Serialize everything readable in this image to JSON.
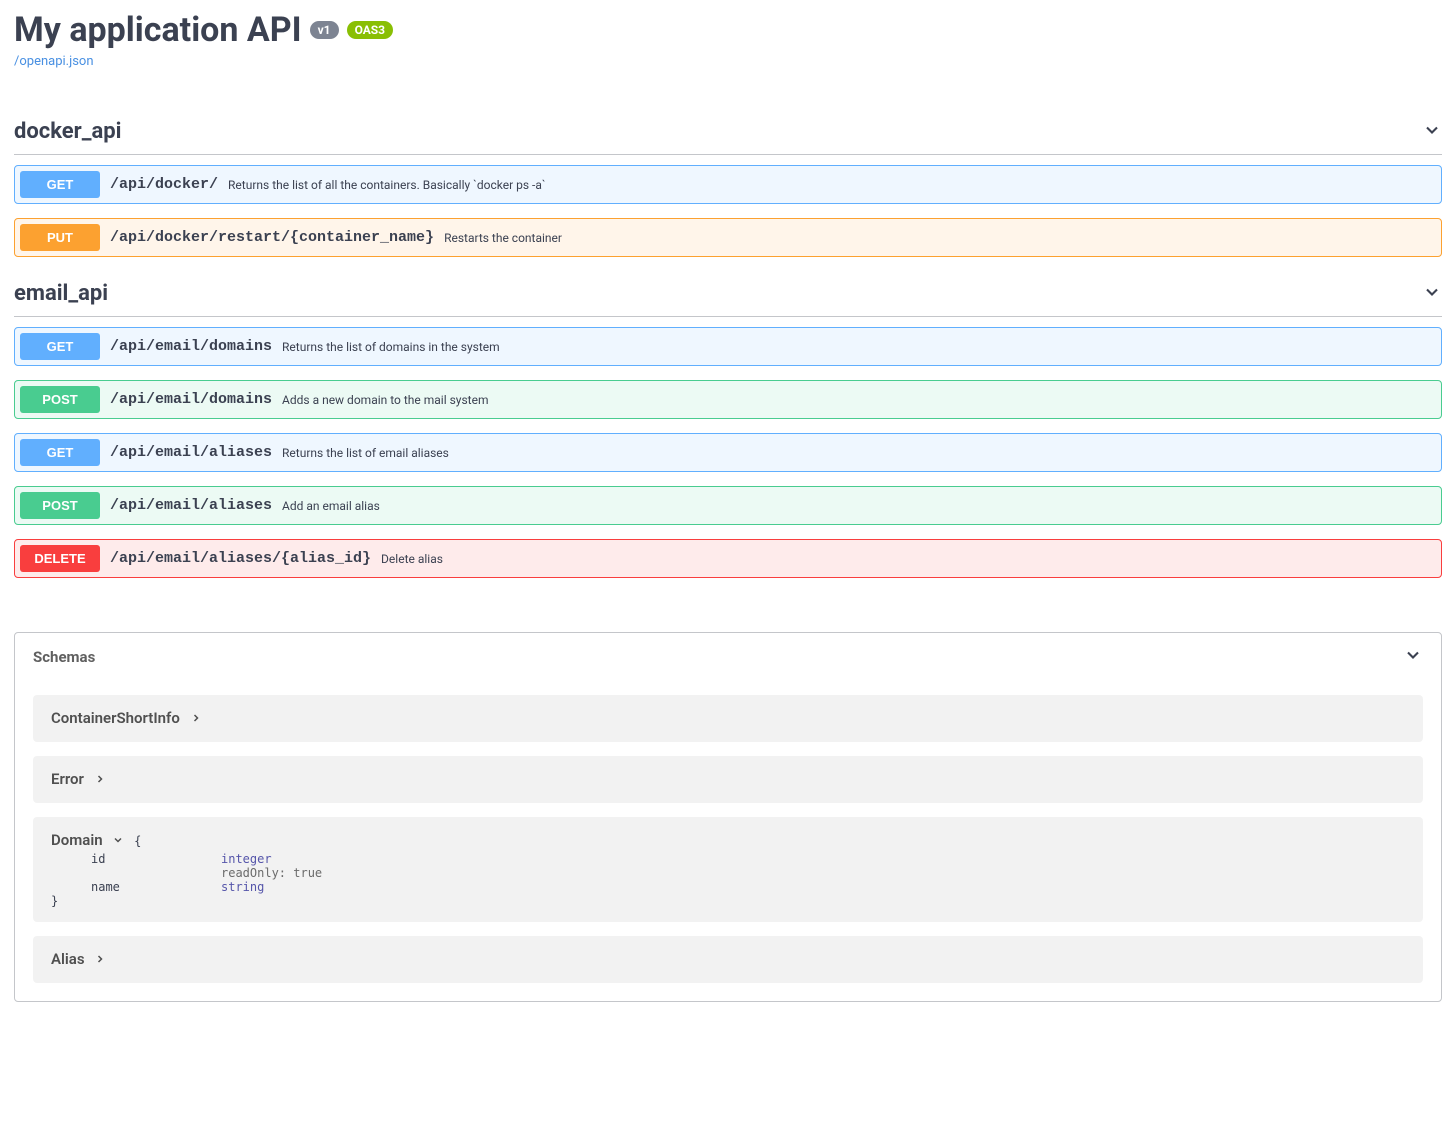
{
  "header": {
    "title": "My application API",
    "version": "v1",
    "oas": "OAS3",
    "spec_link": "/openapi.json"
  },
  "tags": [
    {
      "name": "docker_api",
      "ops": [
        {
          "method": "GET",
          "path": "/api/docker/",
          "summary": "Returns the list of all the containers. Basically `docker ps -a`"
        },
        {
          "method": "PUT",
          "path": "/api/docker/restart/{container_name}",
          "summary": "Restarts the container"
        }
      ]
    },
    {
      "name": "email_api",
      "ops": [
        {
          "method": "GET",
          "path": "/api/email/domains",
          "summary": "Returns the list of domains in the system"
        },
        {
          "method": "POST",
          "path": "/api/email/domains",
          "summary": "Adds a new domain to the mail system"
        },
        {
          "method": "GET",
          "path": "/api/email/aliases",
          "summary": "Returns the list of email aliases"
        },
        {
          "method": "POST",
          "path": "/api/email/aliases",
          "summary": "Add an email alias"
        },
        {
          "method": "DELETE",
          "path": "/api/email/aliases/{alias_id}",
          "summary": "Delete alias"
        }
      ]
    }
  ],
  "schemas": {
    "header": "Schemas",
    "items": [
      {
        "name": "ContainerShortInfo",
        "expanded": false
      },
      {
        "name": "Error",
        "expanded": false
      },
      {
        "name": "Domain",
        "expanded": true,
        "properties": [
          {
            "name": "id",
            "type": "integer",
            "meta": "readOnly: true"
          },
          {
            "name": "name",
            "type": "string"
          }
        ]
      },
      {
        "name": "Alias",
        "expanded": false
      }
    ]
  }
}
